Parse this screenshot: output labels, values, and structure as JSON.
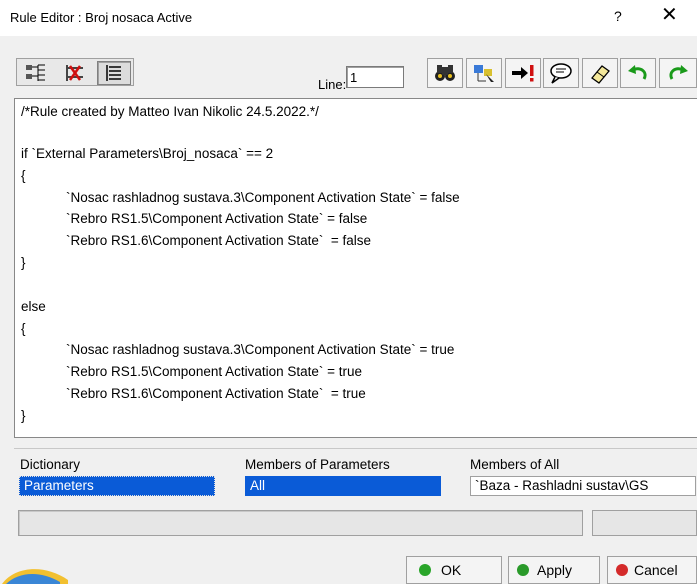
{
  "window": {
    "title": "Rule Editor : Broj nosaca Active",
    "help_glyph": "?",
    "close_glyph": "✕"
  },
  "toolbar": {
    "line_label": "Line:",
    "line_value": "1"
  },
  "editor": {
    "lines": [
      "/*Rule created by Matteo Ivan Nikolic 24.5.2022.*/",
      "",
      "if `External Parameters\\Broj_nosaca` == 2",
      "{",
      "            `Nosac rashladnog sustava.3\\Component Activation State` = false",
      "            `Rebro RS1.5\\Component Activation State` = false",
      "            `Rebro RS1.6\\Component Activation State`  = false",
      "}",
      "",
      "else",
      "{",
      "            `Nosac rashladnog sustava.3\\Component Activation State` = true",
      "            `Rebro RS1.5\\Component Activation State` = true",
      "            `Rebro RS1.6\\Component Activation State`  = true",
      "}"
    ]
  },
  "dictionary": {
    "dictionary_header": "Dictionary",
    "dictionary_selected": "Parameters",
    "members_params_header": "Members of Parameters",
    "members_params_selected": "All",
    "members_all_header": "Members of All",
    "members_all_value": "`Baza - Rashladni sustav\\GS"
  },
  "buttons": {
    "ok_label": "OK",
    "apply_label": "Apply",
    "cancel_label": "Cancel"
  },
  "colors": {
    "selection": "#0a5bd7",
    "ok_dot": "#2aa52a",
    "apply_dot": "#2a9a2a",
    "cancel_dot": "#d42a2a"
  }
}
